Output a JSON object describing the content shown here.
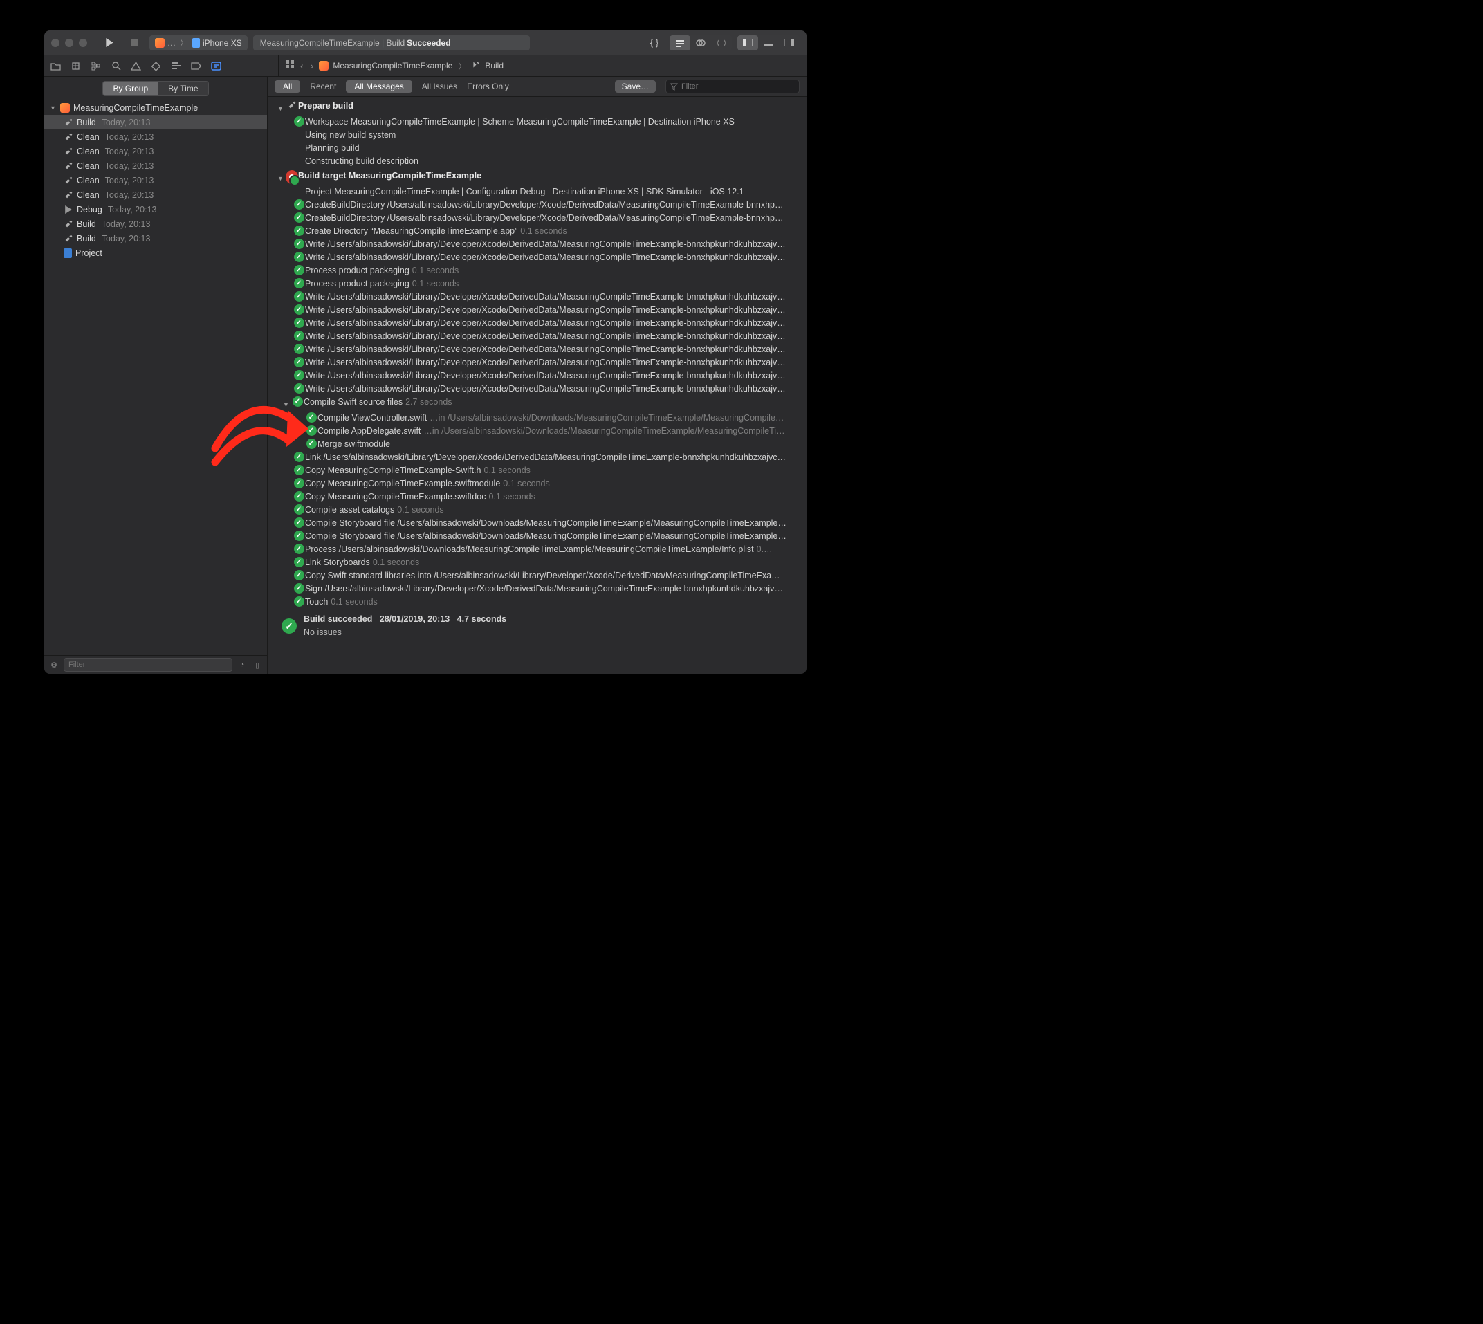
{
  "titlebar": {
    "scheme_prefix": "…",
    "device": "iPhone XS",
    "status_prefix": "MeasuringCompileTimeExample | Build",
    "status_bold": "Succeeded"
  },
  "jump": {
    "project": "MeasuringCompileTimeExample",
    "leaf": "Build"
  },
  "sidebar": {
    "group_tabs": [
      "By Group",
      "By Time"
    ],
    "project": "MeasuringCompileTimeExample",
    "items": [
      {
        "icon": "hammer",
        "label": "Build",
        "time": "Today, 20:13",
        "sel": true
      },
      {
        "icon": "hammer",
        "label": "Clean",
        "time": "Today, 20:13"
      },
      {
        "icon": "hammer",
        "label": "Clean",
        "time": "Today, 20:13"
      },
      {
        "icon": "hammer",
        "label": "Clean",
        "time": "Today, 20:13"
      },
      {
        "icon": "hammer",
        "label": "Clean",
        "time": "Today, 20:13"
      },
      {
        "icon": "hammer",
        "label": "Clean",
        "time": "Today, 20:13"
      },
      {
        "icon": "play",
        "label": "Debug",
        "time": "Today, 20:13"
      },
      {
        "icon": "hammer",
        "label": "Build",
        "time": "Today, 20:13"
      },
      {
        "icon": "hammer",
        "label": "Build",
        "time": "Today, 20:13"
      }
    ],
    "project_leaf": "Project",
    "filter_placeholder": "Filter"
  },
  "filterbar": {
    "all": "All",
    "recent": "Recent",
    "all_messages": "All Messages",
    "all_issues": "All Issues",
    "errors_only": "Errors Only",
    "save": "Save…",
    "filter_placeholder": "Filter"
  },
  "log": {
    "prepare": {
      "title": "Prepare build",
      "sub": "Workspace MeasuringCompileTimeExample | Scheme MeasuringCompileTimeExample | Destination iPhone XS",
      "lines": [
        "Using new build system",
        "Planning build",
        "Constructing build description"
      ]
    },
    "target": {
      "title": "Build target MeasuringCompileTimeExample",
      "sub": "Project MeasuringCompileTimeExample | Configuration Debug | Destination iPhone XS | SDK Simulator - iOS 12.1"
    },
    "steps1": [
      {
        "t": "CreateBuildDirectory /Users/albinsadowski/Library/Developer/Xcode/DerivedData/MeasuringCompileTimeExample-bnnxhp…"
      },
      {
        "t": "CreateBuildDirectory /Users/albinsadowski/Library/Developer/Xcode/DerivedData/MeasuringCompileTimeExample-bnnxhp…"
      },
      {
        "t": "Create Directory “MeasuringCompileTimeExample.app”",
        "d": "0.1 seconds"
      },
      {
        "t": "Write /Users/albinsadowski/Library/Developer/Xcode/DerivedData/MeasuringCompileTimeExample-bnnxhpkunhdkuhbzxajv…"
      },
      {
        "t": "Write /Users/albinsadowski/Library/Developer/Xcode/DerivedData/MeasuringCompileTimeExample-bnnxhpkunhdkuhbzxajv…"
      },
      {
        "t": "Process product packaging",
        "d": "0.1 seconds"
      },
      {
        "t": "Process product packaging",
        "d": "0.1 seconds"
      },
      {
        "t": "Write /Users/albinsadowski/Library/Developer/Xcode/DerivedData/MeasuringCompileTimeExample-bnnxhpkunhdkuhbzxajv…"
      },
      {
        "t": "Write /Users/albinsadowski/Library/Developer/Xcode/DerivedData/MeasuringCompileTimeExample-bnnxhpkunhdkuhbzxajv…"
      },
      {
        "t": "Write /Users/albinsadowski/Library/Developer/Xcode/DerivedData/MeasuringCompileTimeExample-bnnxhpkunhdkuhbzxajv…"
      },
      {
        "t": "Write /Users/albinsadowski/Library/Developer/Xcode/DerivedData/MeasuringCompileTimeExample-bnnxhpkunhdkuhbzxajv…"
      },
      {
        "t": "Write /Users/albinsadowski/Library/Developer/Xcode/DerivedData/MeasuringCompileTimeExample-bnnxhpkunhdkuhbzxajv…"
      },
      {
        "t": "Write /Users/albinsadowski/Library/Developer/Xcode/DerivedData/MeasuringCompileTimeExample-bnnxhpkunhdkuhbzxajv…"
      },
      {
        "t": "Write /Users/albinsadowski/Library/Developer/Xcode/DerivedData/MeasuringCompileTimeExample-bnnxhpkunhdkuhbzxajv…"
      },
      {
        "t": "Write /Users/albinsadowski/Library/Developer/Xcode/DerivedData/MeasuringCompileTimeExample-bnnxhpkunhdkuhbzxajv…"
      }
    ],
    "compile": {
      "title": "Compile Swift source files",
      "d": "2.7 seconds",
      "children": [
        {
          "t": "Compile ViewController.swift",
          "d": "…in /Users/albinsadowski/Downloads/MeasuringCompileTimeExample/MeasuringCompile…"
        },
        {
          "t": "Compile AppDelegate.swift",
          "d": "…in /Users/albinsadowski/Downloads/MeasuringCompileTimeExample/MeasuringCompileTi…"
        },
        {
          "t": "Merge swiftmodule"
        }
      ]
    },
    "steps2": [
      {
        "t": "Link /Users/albinsadowski/Library/Developer/Xcode/DerivedData/MeasuringCompileTimeExample-bnnxhpkunhdkuhbzxajvc…"
      },
      {
        "t": "Copy MeasuringCompileTimeExample-Swift.h",
        "d": "0.1 seconds"
      },
      {
        "t": "Copy MeasuringCompileTimeExample.swiftmodule",
        "d": "0.1 seconds"
      },
      {
        "t": "Copy MeasuringCompileTimeExample.swiftdoc",
        "d": "0.1 seconds"
      },
      {
        "t": "Compile asset catalogs",
        "d": "0.1 seconds"
      },
      {
        "t": "Compile Storyboard file /Users/albinsadowski/Downloads/MeasuringCompileTimeExample/MeasuringCompileTimeExample…"
      },
      {
        "t": "Compile Storyboard file /Users/albinsadowski/Downloads/MeasuringCompileTimeExample/MeasuringCompileTimeExample…"
      },
      {
        "t": "Process /Users/albinsadowski/Downloads/MeasuringCompileTimeExample/MeasuringCompileTimeExample/Info.plist",
        "d": "0.…"
      },
      {
        "t": "Link Storyboards",
        "d": "0.1 seconds"
      },
      {
        "t": "Copy Swift standard libraries into /Users/albinsadowski/Library/Developer/Xcode/DerivedData/MeasuringCompileTimeExa…"
      },
      {
        "t": "Sign /Users/albinsadowski/Library/Developer/Xcode/DerivedData/MeasuringCompileTimeExample-bnnxhpkunhdkuhbzxajv…"
      },
      {
        "t": "Touch",
        "d": "0.1 seconds"
      }
    ],
    "summary": {
      "title": "Build succeeded",
      "date": "28/01/2019, 20:13",
      "dur": "4.7 seconds",
      "sub": "No issues"
    }
  }
}
